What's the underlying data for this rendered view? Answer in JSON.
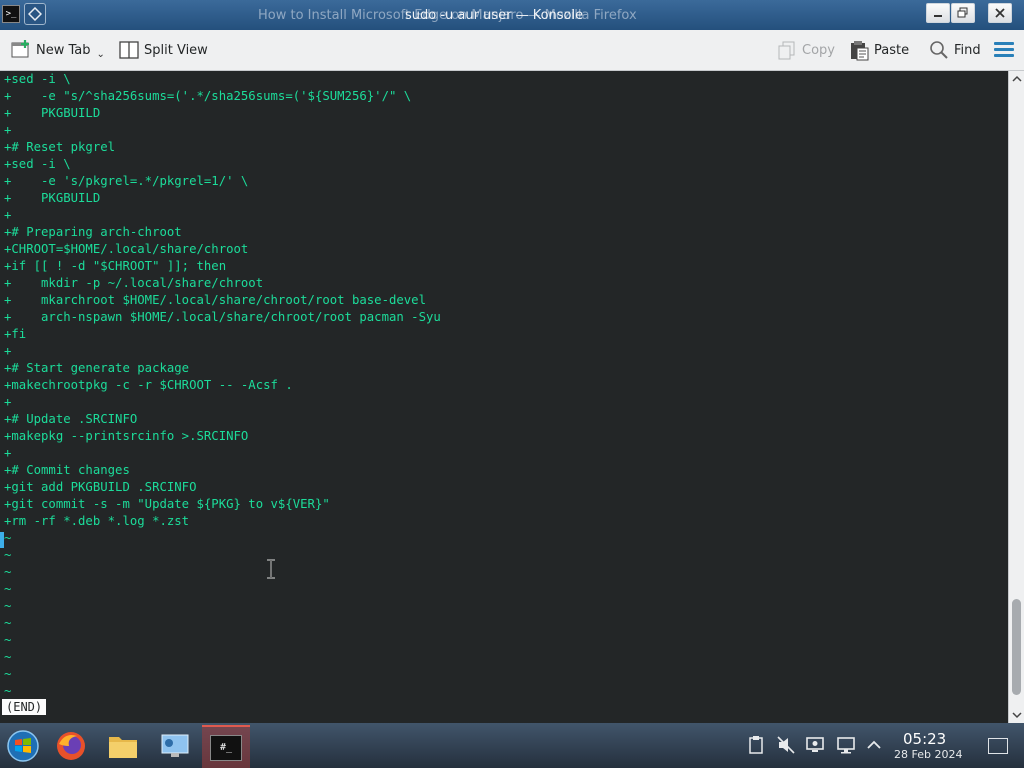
{
  "window": {
    "ghost_title": "How to Install Microsoft Edge on Manjaro — Mozilla Firefox",
    "title": "sudo -u aur user — Konsole",
    "app_icon_text": ">_"
  },
  "toolbar": {
    "new_tab": "New Tab",
    "split_view": "Split View",
    "copy": "Copy",
    "paste": "Paste",
    "find": "Find"
  },
  "terminal": {
    "lines": [
      "+sed -i \\",
      "+    -e \"s/^sha256sums=('.*/sha256sums=('${SUM256}'/\" \\",
      "+    PKGBUILD",
      "+",
      "+# Reset pkgrel",
      "+sed -i \\",
      "+    -e 's/pkgrel=.*/pkgrel=1/' \\",
      "+    PKGBUILD",
      "+",
      "+# Preparing arch-chroot",
      "+CHROOT=$HOME/.local/share/chroot",
      "+if [[ ! -d \"$CHROOT\" ]]; then",
      "+    mkdir -p ~/.local/share/chroot",
      "+    mkarchroot $HOME/.local/share/chroot/root base-devel",
      "+    arch-nspawn $HOME/.local/share/chroot/root pacman -Syu",
      "+fi",
      "+",
      "+# Start generate package",
      "+makechrootpkg -c -r $CHROOT -- -Acsf .",
      "+",
      "+# Update .SRCINFO",
      "+makepkg --printsrcinfo >.SRCINFO",
      "+",
      "+# Commit changes",
      "+git add PKGBUILD .SRCINFO",
      "+git commit -s -m \"Update ${PKG} to v${VER}\"",
      "+rm -rf *.deb *.log *.zst"
    ],
    "tildes": "~\n~\n~\n~\n~\n~\n~\n~\n~\n~",
    "status": "(END)"
  },
  "taskbar": {
    "time": "05:23",
    "date": "28 Feb 2024",
    "konsole_label": "#_"
  },
  "colors": {
    "terminal_bg": "#232627",
    "terminal_fg": "#1cdc9a",
    "accent": "#3daee9"
  }
}
